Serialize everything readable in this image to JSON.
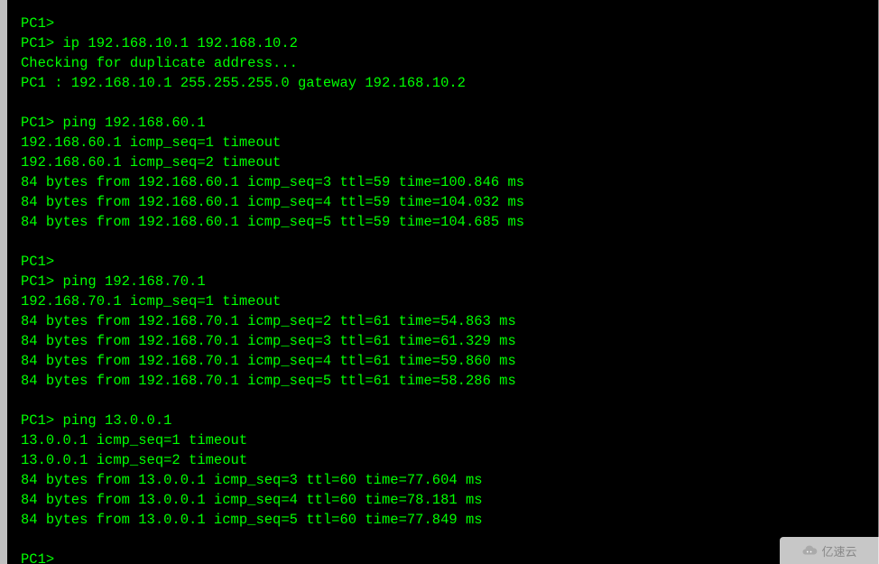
{
  "terminal": {
    "lines": [
      "PC1>",
      "PC1> ip 192.168.10.1 192.168.10.2",
      "Checking for duplicate address...",
      "PC1 : 192.168.10.1 255.255.255.0 gateway 192.168.10.2",
      "",
      "PC1> ping 192.168.60.1",
      "192.168.60.1 icmp_seq=1 timeout",
      "192.168.60.1 icmp_seq=2 timeout",
      "84 bytes from 192.168.60.1 icmp_seq=3 ttl=59 time=100.846 ms",
      "84 bytes from 192.168.60.1 icmp_seq=4 ttl=59 time=104.032 ms",
      "84 bytes from 192.168.60.1 icmp_seq=5 ttl=59 time=104.685 ms",
      "",
      "PC1>",
      "PC1> ping 192.168.70.1",
      "192.168.70.1 icmp_seq=1 timeout",
      "84 bytes from 192.168.70.1 icmp_seq=2 ttl=61 time=54.863 ms",
      "84 bytes from 192.168.70.1 icmp_seq=3 ttl=61 time=61.329 ms",
      "84 bytes from 192.168.70.1 icmp_seq=4 ttl=61 time=59.860 ms",
      "84 bytes from 192.168.70.1 icmp_seq=5 ttl=61 time=58.286 ms",
      "",
      "PC1> ping 13.0.0.1",
      "13.0.0.1 icmp_seq=1 timeout",
      "13.0.0.1 icmp_seq=2 timeout",
      "84 bytes from 13.0.0.1 icmp_seq=3 ttl=60 time=77.604 ms",
      "84 bytes from 13.0.0.1 icmp_seq=4 ttl=60 time=78.181 ms",
      "84 bytes from 13.0.0.1 icmp_seq=5 ttl=60 time=77.849 ms",
      "",
      "PC1>"
    ]
  },
  "watermark": {
    "text": "亿速云"
  }
}
